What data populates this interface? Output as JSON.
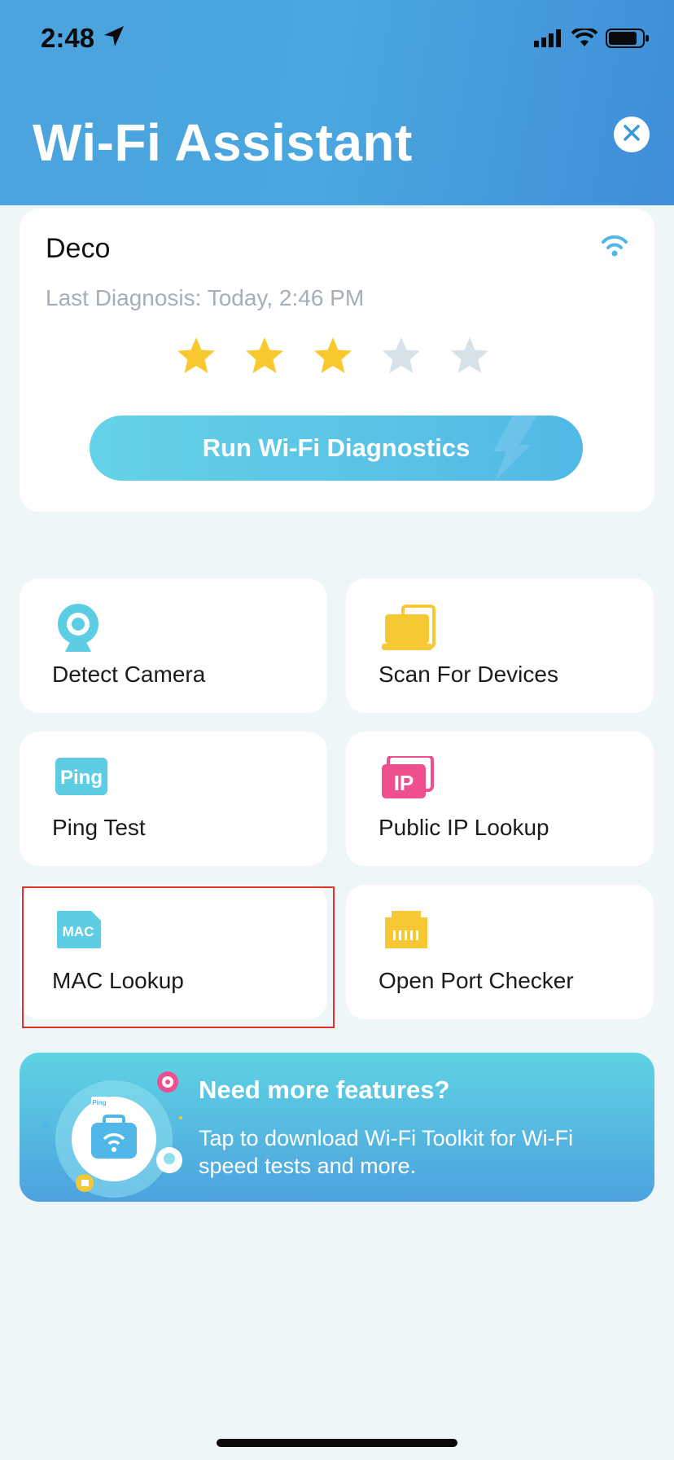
{
  "status_bar": {
    "time": "2:48"
  },
  "header": {
    "title": "Wi-Fi Assistant"
  },
  "deco": {
    "name": "Deco",
    "last_diagnosis": "Last Diagnosis: Today, 2:46 PM",
    "rating": 3,
    "rating_max": 5,
    "run_button": "Run Wi-Fi Diagnostics"
  },
  "tools": [
    {
      "label": "Detect Camera",
      "icon": "camera-icon"
    },
    {
      "label": "Scan For Devices",
      "icon": "devices-icon"
    },
    {
      "label": "Ping Test",
      "icon": "ping-icon",
      "icon_text": "Ping"
    },
    {
      "label": "Public IP Lookup",
      "icon": "ip-icon",
      "icon_text": "IP"
    },
    {
      "label": "MAC Lookup",
      "icon": "mac-icon",
      "icon_text": "MAC"
    },
    {
      "label": "Open Port Checker",
      "icon": "port-icon"
    }
  ],
  "banner": {
    "title": "Need more features?",
    "description": "Tap to download Wi-Fi Toolkit for Wi-Fi speed tests and more.",
    "illus_text": "Ping"
  },
  "colors": {
    "accent": "#5bc6e5",
    "star_on": "#f9c82e",
    "star_off": "#d6e2e8",
    "ip_pink": "#ef4f8f",
    "yellow": "#f6c934",
    "highlight": "#e0322a"
  }
}
